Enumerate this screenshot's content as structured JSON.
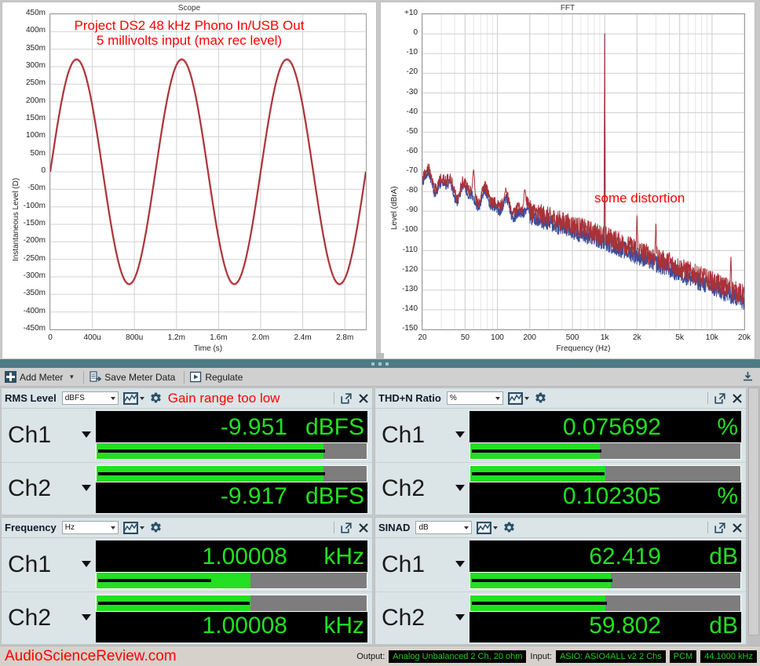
{
  "window": {
    "bg": "#c8c8c8",
    "accent_teal": "#4e7b84",
    "lcd_green": "#22e022",
    "annotation_red": "#ff0000"
  },
  "toolbar": {
    "add_meter_label": "Add Meter",
    "save_meter_data_label": "Save Meter Data",
    "regulate_label": "Regulate",
    "export_icon": "save-download-icon"
  },
  "charts": [
    {
      "id": "scope",
      "title": "Scope",
      "annotation": "Project DS2 48 kHz Phono In/USB Out\n5 millivolts input (max rec level)"
    },
    {
      "id": "fft",
      "title": "FFT",
      "annotation": "some distortion"
    }
  ],
  "chart_data": [
    {
      "type": "line",
      "id": "scope",
      "title": "Scope",
      "xlabel": "Time (s)",
      "ylabel": "Instantaneous Level (D)",
      "xlim": [
        0,
        0.003
      ],
      "ylim": [
        -0.45,
        0.45
      ],
      "grid": true,
      "xtick_labels": [
        "0",
        "400u",
        "800u",
        "1.2m",
        "1.6m",
        "2.0m",
        "2.4m",
        "2.8m"
      ],
      "xtick_values": [
        0,
        0.0004,
        0.0008,
        0.0012,
        0.0016,
        0.002,
        0.0024,
        0.0028
      ],
      "ytick_labels": [
        "450m",
        "400m",
        "350m",
        "300m",
        "250m",
        "200m",
        "150m",
        "100m",
        "50m",
        "0",
        "-50m",
        "-100m",
        "-150m",
        "-200m",
        "-250m",
        "-300m",
        "-350m",
        "-400m",
        "-450m"
      ],
      "ytick_values": [
        0.45,
        0.4,
        0.35,
        0.3,
        0.25,
        0.2,
        0.15,
        0.1,
        0.05,
        0,
        -0.05,
        -0.1,
        -0.15,
        -0.2,
        -0.25,
        -0.3,
        -0.35,
        -0.4,
        -0.45
      ],
      "series": [
        {
          "name": "Ch1",
          "color": "#a83238",
          "waveform": "sine",
          "amplitude": 0.32,
          "frequency_hz": 1000.08,
          "phase_deg": 0,
          "description": "1 kHz sine, peak 320 mV, 3 cycles shown"
        },
        {
          "name": "Ch2",
          "color": "#e8a0a4",
          "waveform": "sine",
          "amplitude": 0.322,
          "frequency_hz": 1000.08,
          "phase_deg": 0,
          "description": "overlapping second channel, nearly identical"
        }
      ]
    },
    {
      "type": "line",
      "id": "fft",
      "title": "FFT",
      "xlabel": "Frequency (Hz)",
      "ylabel": "Level (dBrA)",
      "xscale": "log",
      "xlim": [
        20,
        20000
      ],
      "ylim": [
        -150,
        10
      ],
      "grid": true,
      "xtick_labels": [
        "20",
        "50",
        "100",
        "200",
        "500",
        "1k",
        "2k",
        "5k",
        "10k",
        "20k"
      ],
      "xtick_values": [
        20,
        50,
        100,
        200,
        500,
        1000,
        2000,
        5000,
        10000,
        20000
      ],
      "ytick_labels": [
        "+10",
        "0",
        "-10",
        "-20",
        "-30",
        "-40",
        "-50",
        "-60",
        "-70",
        "-80",
        "-90",
        "-100",
        "-110",
        "-120",
        "-130",
        "-140",
        "-150"
      ],
      "ytick_values": [
        10,
        0,
        -10,
        -20,
        -30,
        -40,
        -50,
        -60,
        -70,
        -80,
        -90,
        -100,
        -110,
        -120,
        -130,
        -140,
        -150
      ],
      "series": [
        {
          "name": "Ch1",
          "color": "#a83238",
          "fundamental_hz": 1000,
          "fundamental_db": 0,
          "noise_floor_at_20hz_db": -72,
          "noise_floor_at_1khz_db": -103,
          "noise_floor_at_20khz_db": -133,
          "harmonics": [
            {
              "hz": 2000,
              "db": -92
            },
            {
              "hz": 3000,
              "db": -96
            },
            {
              "hz": 4000,
              "db": -111
            },
            {
              "hz": 15000,
              "db": -113
            }
          ],
          "mains_spurs": [
            {
              "hz": 60,
              "db": -69
            },
            {
              "hz": 120,
              "db": -80
            },
            {
              "hz": 180,
              "db": -79
            }
          ]
        },
        {
          "name": "Ch2",
          "color": "#3b4d99",
          "fundamental_hz": 1000,
          "fundamental_db": 0,
          "noise_floor_at_20hz_db": -74,
          "noise_floor_at_1khz_db": -106,
          "noise_floor_at_20khz_db": -136
        }
      ],
      "annotations": [
        {
          "text": "some distortion",
          "color": "#ff0000"
        }
      ]
    }
  ],
  "meters": [
    {
      "title": "RMS Level",
      "unit_selected": "dBFS",
      "warning": "Gain range too low",
      "channels": [
        {
          "name": "Ch1",
          "value": "-9.951",
          "unit": "dBFS",
          "bar_pct": 84,
          "peak_pct": 84
        },
        {
          "name": "Ch2",
          "value": "-9.917",
          "unit": "dBFS",
          "bar_pct": 84,
          "peak_pct": 84
        }
      ]
    },
    {
      "title": "THD+N Ratio",
      "unit_selected": "%",
      "warning": "",
      "channels": [
        {
          "name": "Ch1",
          "value": "0.075692",
          "unit": "%",
          "bar_pct": 48,
          "peak_pct": 48
        },
        {
          "name": "Ch2",
          "value": "0.102305",
          "unit": "%",
          "bar_pct": 50,
          "peak_pct": 49
        }
      ]
    },
    {
      "title": "Frequency",
      "unit_selected": "Hz",
      "warning": "",
      "channels": [
        {
          "name": "Ch1",
          "value": "1.00008",
          "unit": "kHz",
          "bar_pct": 57,
          "peak_pct": 42
        },
        {
          "name": "Ch2",
          "value": "1.00008",
          "unit": "kHz",
          "bar_pct": 57,
          "peak_pct": 56
        }
      ]
    },
    {
      "title": "SINAD",
      "unit_selected": "dB",
      "warning": "",
      "channels": [
        {
          "name": "Ch1",
          "value": "62.419",
          "unit": "dB",
          "bar_pct": 52,
          "peak_pct": 52
        },
        {
          "name": "Ch2",
          "value": "59.802",
          "unit": "dB",
          "bar_pct": 50,
          "peak_pct": 50
        }
      ]
    }
  ],
  "status": {
    "site": "AudioScienceReview.com",
    "output_label": "Output:",
    "output_value": "Analog Unbalanced 2 Ch, 20 ohm",
    "input_label": "Input:",
    "input_value": "ASIO: ASIO4ALL v2 2 Chs",
    "format": "PCM",
    "rate": "44.1000 kHz"
  }
}
